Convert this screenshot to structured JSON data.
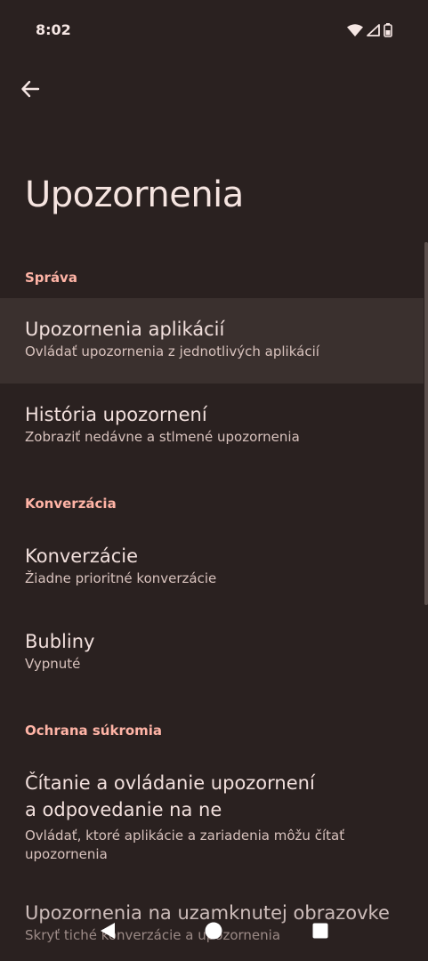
{
  "status_bar": {
    "time": "8:02",
    "icons": [
      "wifi-icon",
      "cell-signal-icon",
      "battery-icon"
    ]
  },
  "header": {
    "back_icon": "arrow-back-icon",
    "title": "Upozornenia"
  },
  "sections": [
    {
      "header": "Správa",
      "items": [
        {
          "title": "Upozornenia aplikácií",
          "subtitle": "Ovládať upozornenia z jednotlivých aplikácií",
          "highlighted": true
        },
        {
          "title": "História upozornení",
          "subtitle": "Zobraziť nedávne a stlmené upozornenia"
        }
      ]
    },
    {
      "header": "Konverzácia",
      "items": [
        {
          "title": "Konverzácie",
          "subtitle": "Žiadne prioritné konverzácie"
        },
        {
          "title": "Bubliny",
          "subtitle": "Vypnuté"
        }
      ]
    },
    {
      "header": "Ochrana súkromia",
      "items": [
        {
          "title_line1": "Čítanie a ovládanie upozornení",
          "title_line2": "a odpovedanie na ne",
          "subtitle_line1": "Ovládať, ktoré aplikácie a zariadenia môžu čítať",
          "subtitle_line2": "upozornenia"
        },
        {
          "title": "Upozornenia na uzamknutej obrazovke",
          "subtitle": "Skryť tiché konverzácie a upozornenia"
        }
      ]
    }
  ],
  "nav_bar": {
    "icons": [
      "nav-back-icon",
      "nav-home-icon",
      "nav-recents-icon"
    ]
  },
  "colors": {
    "background": "#2a2120",
    "accent": "#ffb4a6",
    "highlight": "#3a302e"
  }
}
